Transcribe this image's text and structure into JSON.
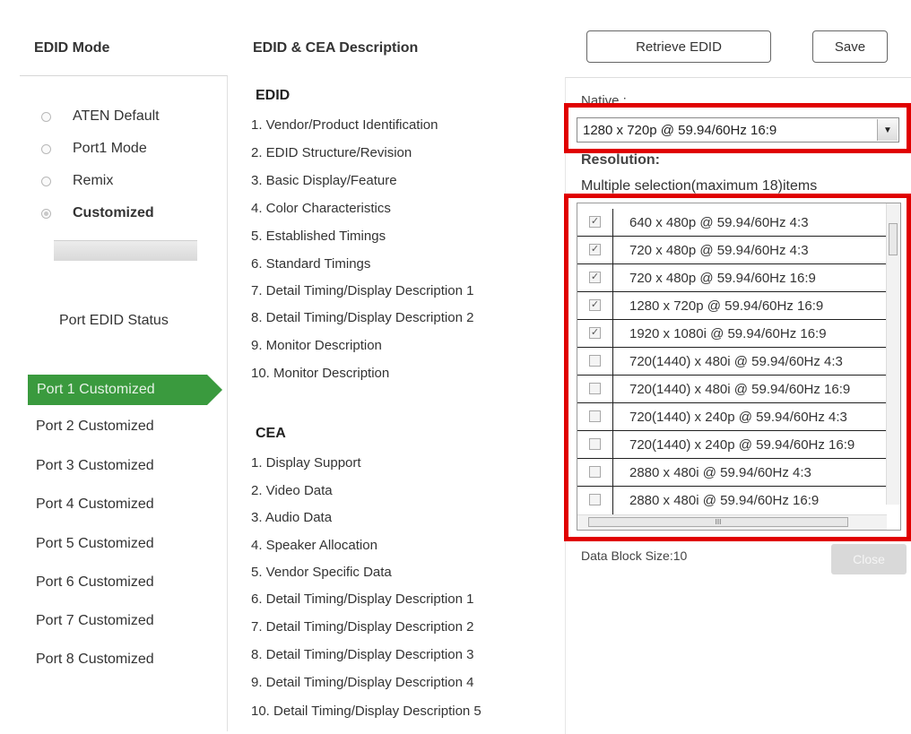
{
  "header": {
    "edid_mode": "EDID Mode",
    "edid_cea_description": "EDID & CEA Description",
    "retrieve_btn": "Retrieve EDID",
    "save_btn": "Save"
  },
  "modes": [
    {
      "label": "ATEN Default",
      "selected": false
    },
    {
      "label": "Port1 Mode",
      "selected": false
    },
    {
      "label": "Remix",
      "selected": false
    },
    {
      "label": "Customized",
      "selected": true
    }
  ],
  "port_status_title": "Port EDID Status",
  "ports": [
    {
      "label": "Port 1  Customized",
      "active": true
    },
    {
      "label": "Port 2  Customized"
    },
    {
      "label": "Port 3  Customized"
    },
    {
      "label": "Port 4  Customized"
    },
    {
      "label": "Port 5  Customized"
    },
    {
      "label": "Port 6  Customized"
    },
    {
      "label": "Port 7  Customized"
    },
    {
      "label": "Port 8  Customized"
    }
  ],
  "edid": {
    "title": "EDID",
    "items": [
      "1.  Vendor/Product Identification",
      "2.  EDID Structure/Revision",
      "3.  Basic Display/Feature",
      "4.  Color Characteristics",
      "5.  Established Timings",
      "6.  Standard Timings",
      "7.  Detail Timing/Display Description 1",
      "8.  Detail Timing/Display Description 2",
      "9.  Monitor Description",
      "10.  Monitor Description"
    ]
  },
  "cea": {
    "title": "CEA",
    "items": [
      "1.  Display Support",
      "2.  Video Data",
      "3.  Audio Data",
      "4.  Speaker Allocation",
      "5.  Vendor Specific Data",
      "6.  Detail Timing/Display Description 1",
      "7.  Detail Timing/Display Description 2",
      "8.  Detail Timing/Display Description 3",
      "9.  Detail Timing/Display Description 4",
      "10.  Detail Timing/Display Description 5"
    ]
  },
  "native": {
    "label": "Native :",
    "value": "1280 x 720p @ 59.94/60Hz 16:9"
  },
  "resolution": {
    "title": "Resolution:",
    "hint": "Multiple selection(maximum 18)items",
    "items": [
      {
        "label": "640 x 480p @ 59.94/60Hz 4:3",
        "checked": true
      },
      {
        "label": "720 x 480p @ 59.94/60Hz 4:3",
        "checked": true
      },
      {
        "label": "720 x 480p @ 59.94/60Hz 16:9",
        "checked": true
      },
      {
        "label": "1280 x 720p @ 59.94/60Hz 16:9",
        "checked": true
      },
      {
        "label": "1920 x 1080i @ 59.94/60Hz 16:9",
        "checked": true
      },
      {
        "label": "720(1440) x 480i @ 59.94/60Hz 4:3",
        "checked": false
      },
      {
        "label": "720(1440) x 480i @ 59.94/60Hz 16:9",
        "checked": false
      },
      {
        "label": "720(1440) x 240p @ 59.94/60Hz 4:3",
        "checked": false
      },
      {
        "label": "720(1440) x 240p @ 59.94/60Hz 16:9",
        "checked": false
      },
      {
        "label": "2880 x 480i @ 59.94/60Hz 4:3",
        "checked": false
      },
      {
        "label": "2880 x 480i @ 59.94/60Hz 16:9",
        "checked": false
      }
    ],
    "scroll_mark": "III"
  },
  "data_block_size": "Data Block Size:10",
  "apply_btn": "Close"
}
